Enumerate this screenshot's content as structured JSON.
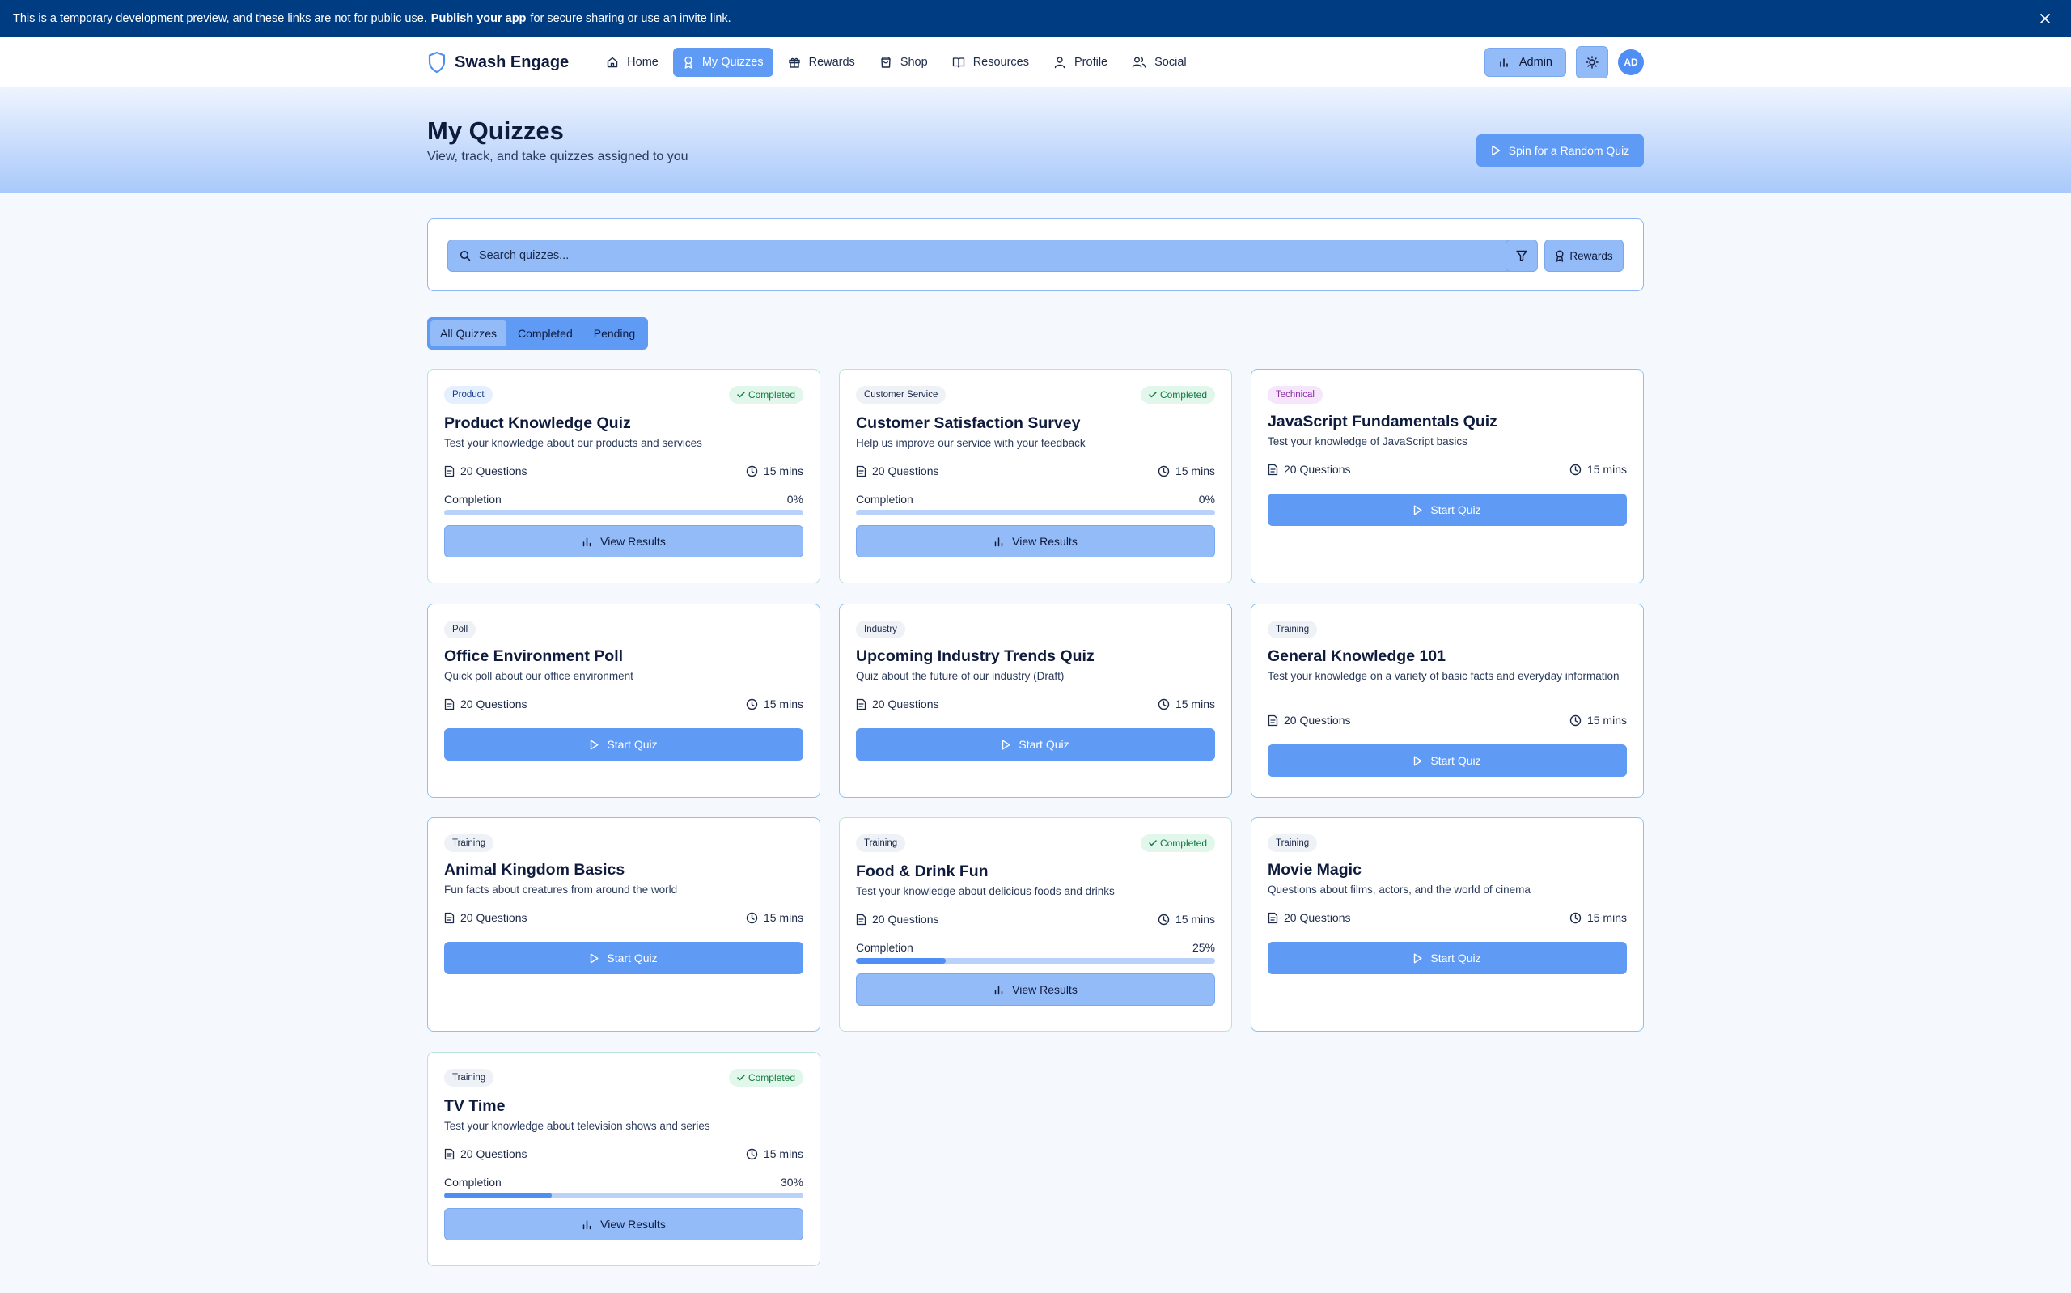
{
  "banner": {
    "text_before": "This is a temporary development preview, and these links are not for public use.",
    "link": "Publish your app",
    "text_after": "for secure sharing or use an invite link."
  },
  "nav": {
    "brand": "Swash Engage",
    "links": [
      {
        "label": "Home",
        "icon": "home-icon"
      },
      {
        "label": "My Quizzes",
        "icon": "award-icon",
        "active": true
      },
      {
        "label": "Rewards",
        "icon": "gift-icon"
      },
      {
        "label": "Shop",
        "icon": "shopping-bag-icon"
      },
      {
        "label": "Resources",
        "icon": "book-icon"
      },
      {
        "label": "Profile",
        "icon": "user-icon"
      },
      {
        "label": "Social",
        "icon": "users-icon"
      }
    ],
    "admin_label": "Admin",
    "avatar_initials": "AD"
  },
  "hero": {
    "title": "My Quizzes",
    "subtitle": "View, track, and take quizzes assigned to you",
    "spin_label": "Spin for a Random Quiz"
  },
  "search": {
    "placeholder": "Search quizzes...",
    "value": "",
    "rewards_label": "Rewards"
  },
  "tabs": [
    {
      "label": "All Quizzes",
      "active": true
    },
    {
      "label": "Completed",
      "active": false
    },
    {
      "label": "Pending",
      "active": false
    }
  ],
  "labels": {
    "completed": "Completed",
    "completion": "Completion",
    "start_quiz": "Start Quiz",
    "view_results": "View Results"
  },
  "quizzes": [
    {
      "category": "Product",
      "category_color": "blue",
      "title": "Product Knowledge Quiz",
      "description": "Test your knowledge about our products and services",
      "questions": "20 Questions",
      "duration": "15 mins",
      "completed": true,
      "completion": "0%",
      "progress": 0
    },
    {
      "category": "Customer Service",
      "category_color": "gray",
      "title": "Customer Satisfaction Survey",
      "description": "Help us improve our service with your feedback",
      "questions": "20 Questions",
      "duration": "15 mins",
      "completed": true,
      "completion": "0%",
      "progress": 0
    },
    {
      "category": "Technical",
      "category_color": "purple",
      "title": "JavaScript Fundamentals Quiz",
      "description": "Test your knowledge of JavaScript basics",
      "questions": "20 Questions",
      "duration": "15 mins",
      "completed": false
    },
    {
      "category": "Poll",
      "category_color": "gray",
      "title": "Office Environment Poll",
      "description": "Quick poll about our office environment",
      "questions": "20 Questions",
      "duration": "15 mins",
      "completed": false
    },
    {
      "category": "Industry",
      "category_color": "gray",
      "title": "Upcoming Industry Trends Quiz",
      "description": "Quiz about the future of our industry (Draft)",
      "questions": "20 Questions",
      "duration": "15 mins",
      "completed": false
    },
    {
      "category": "Training",
      "category_color": "gray",
      "title": "General Knowledge 101",
      "description": "Test your knowledge on a variety of basic facts and everyday information",
      "questions": "20 Questions",
      "duration": "15 mins",
      "completed": false
    },
    {
      "category": "Training",
      "category_color": "gray",
      "title": "Animal Kingdom Basics",
      "description": "Fun facts about creatures from around the world",
      "questions": "20 Questions",
      "duration": "15 mins",
      "completed": false
    },
    {
      "category": "Training",
      "category_color": "gray",
      "title": "Food & Drink Fun",
      "description": "Test your knowledge about delicious foods and drinks",
      "questions": "20 Questions",
      "duration": "15 mins",
      "completed": true,
      "completion": "25%",
      "progress": 25
    },
    {
      "category": "Training",
      "category_color": "gray",
      "title": "Movie Magic",
      "description": "Questions about films, actors, and the world of cinema",
      "questions": "20 Questions",
      "duration": "15 mins",
      "completed": false
    },
    {
      "category": "Training",
      "category_color": "gray",
      "title": "TV Time",
      "description": "Test your knowledge about television shows and series",
      "questions": "20 Questions",
      "duration": "15 mins",
      "completed": true,
      "completion": "30%",
      "progress": 30
    }
  ]
}
